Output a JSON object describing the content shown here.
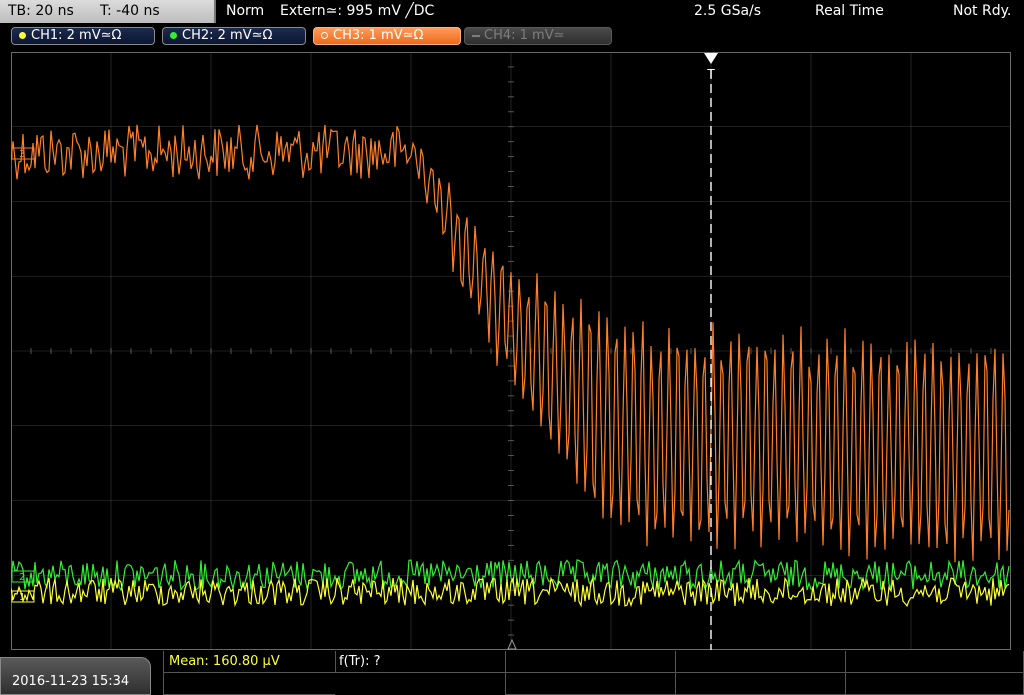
{
  "status_bar": {
    "timebase": "TB: 20 ns",
    "trigger_time": "T: -40 ns",
    "trigger_mode": "Norm",
    "trigger_source": "Extern≃: 995 mV ╱DC",
    "sample_rate": "2.5 GSa/s",
    "acq_mode": "Real Time",
    "run_state": "Not Rdy."
  },
  "channels": [
    {
      "label": "CH1: 2 mV≃Ω",
      "color": "#ffff33",
      "state": "on"
    },
    {
      "label": "CH2: 2 mV≃Ω",
      "color": "#33ee33",
      "state": "on"
    },
    {
      "label": "CH3: 1 mV≃Ω",
      "color": "#ff7f2a",
      "state": "selected"
    },
    {
      "label": "CH4: 1 mV≃",
      "color": "#7d7d7d",
      "state": "off"
    }
  ],
  "trigger_marker": "T",
  "ref_markers": {
    "ch3": "3",
    "ch2": "2",
    "ch1": "1"
  },
  "bottom_bar": {
    "datetime": "2016-11-23 15:34",
    "measurement_1": "Mean: 160.80 µV",
    "measurement_2": "f(Tr): ?"
  },
  "colors": {
    "ch1": "#ffff33",
    "ch2": "#33ee33",
    "ch3": "#ff7f2a",
    "grid": "#6a6a6a",
    "measurement_1": "#ffff33"
  }
}
